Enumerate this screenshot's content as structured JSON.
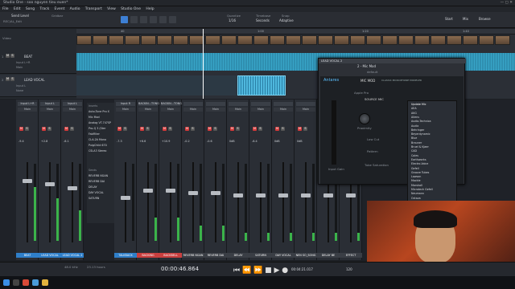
{
  "window_title": "Studio One - soo nguyen tieu euen*",
  "menu": [
    "File",
    "Edit",
    "Song",
    "Track",
    "Event",
    "Audio",
    "Transport",
    "View",
    "Studio One",
    "Help"
  ],
  "toolbar": {
    "song_label": "Send Level",
    "song_sub": "REC/AL_Edit",
    "gridbox": "Gridbar",
    "quantize_label": "Quantize",
    "quantize_value": "1/16",
    "timebase_label": "Timebase",
    "timebase_value": "Seconds",
    "snap_label": "Snap",
    "snap_value": "Adaptive",
    "start_label": "Start",
    "mix_label": "Mix",
    "browse_label": "Browse",
    "pct": "45%"
  },
  "tracks": [
    {
      "num": "1",
      "name": "BEAT",
      "io": "Input L+R",
      "out": "Main",
      "mute": "M",
      "solo": "S"
    },
    {
      "num": "2",
      "name": "LEAD VOCAL",
      "io": "Input L",
      "out": "None",
      "mute": "M",
      "solo": "S"
    }
  ],
  "ruler": [
    "40",
    "1:00",
    "1:20",
    "1:40"
  ],
  "mixer": {
    "strips": [
      {
        "input": "Input L+R",
        "main": "Main",
        "vol": "-9.4",
        "label": "BEAT",
        "color": "#2f7fc9",
        "level": 0.7
      },
      {
        "input": "Input L",
        "main": "Main",
        "vol": "+2.8",
        "label": "LEAD VOCAL",
        "color": "#2f7fc9",
        "level": 0.55
      },
      {
        "input": "Input L",
        "main": "Main",
        "vol": "-6.1",
        "label": "LEAD VOCAL 2",
        "color": "#2f7fc9",
        "level": 0.4
      },
      {
        "input": "Input R",
        "main": "Main",
        "vol": "-7.3",
        "label": "TALKBACK",
        "color": "#2f7fc9",
        "level": 0.0
      },
      {
        "input": "BACKIN...TONG",
        "main": "Main",
        "vol": "+6.6",
        "label": "BACKING",
        "color": "#c93f3f",
        "level": 0.3
      },
      {
        "input": "BACKIN...TONG",
        "main": "Main",
        "vol": "+10.9",
        "label": "BACKBELL",
        "color": "#c93f3f",
        "level": 0.3
      },
      {
        "input": "",
        "main": "Main",
        "vol": "-0.2",
        "label": "REVERB NGAN",
        "color": "#3a3e45",
        "level": 0.2
      },
      {
        "input": "",
        "main": "Main",
        "vol": "-0.6",
        "label": "REVERB DAI",
        "color": "#3a3e45",
        "level": 0.2
      },
      {
        "input": "",
        "main": "Main",
        "vol": "0dB",
        "label": "DELAY",
        "color": "#3a3e45",
        "level": 0.1
      },
      {
        "input": "",
        "main": "Main",
        "vol": "-6.4",
        "label": "SATURN",
        "color": "#3a3e45",
        "level": 0.1
      },
      {
        "input": "",
        "main": "Main",
        "vol": "0dB",
        "label": "DAY VOCAL",
        "color": "#3a3e45",
        "level": 0.1
      },
      {
        "input": "",
        "main": "Main",
        "vol": "0dB",
        "label": "NEN SO_SONG",
        "color": "#3a3e45",
        "level": 0.1
      },
      {
        "input": "",
        "main": "Main",
        "vol": "-4.0",
        "label": "DELAY BE",
        "color": "#3a3e45",
        "level": 0.1
      },
      {
        "input": "",
        "main": "Main",
        "vol": "0dB",
        "label": "EFFECT",
        "color": "#3a3e45",
        "level": 0.1
      }
    ],
    "inserts": [
      "Inserts",
      "Auto-Tune Pro X",
      "Mic Mod",
      "Analog VT-747SP",
      "Pro-Q 3 (Ster",
      "FabFilter",
      "CLA-2A Mono",
      "PuigChild 670",
      "CSLA3 Stereo"
    ],
    "sends": [
      "Sends",
      "REVERB NGAN",
      "REVERB DAI",
      "DELAY",
      "DAY VOCAL",
      "SATURN"
    ]
  },
  "plugin": {
    "title": "LEAD VOCAL 2",
    "slot": "2 - Mic Mod",
    "preset": "default",
    "brand": "Antares",
    "product": "MIC MOD",
    "subtitle": "CLASSIC MICROPHONE MODELER",
    "source_label": "SOURCE MIC",
    "source_value": "Apple Pro",
    "proximity": "Proximity",
    "lowcut": "Low Cut",
    "pattern": "Pattern",
    "tube": "Tube Saturation",
    "input_gain": "Input Gain",
    "mic_list": [
      "Update Mic",
      "AEA",
      "AKG",
      "Aliens",
      "Audio-Technica",
      "Audix",
      "Behringer",
      "Beyerdynamic",
      "Blue",
      "Brauner",
      "Bruel & Kjaer",
      "CAD",
      "Coles",
      "Earthworks",
      "Electro-Voice",
      "Gefell",
      "Groove Tubes",
      "Lawson",
      "Mackie",
      "Marshall",
      "Microtech Gefell",
      "Neumann",
      "Octava"
    ]
  },
  "transport": {
    "time": "00:00:46.864",
    "length": "00:04:21.017",
    "sample_rate": "48.0 kHz",
    "hours": "23.13 hours",
    "tempo": "120"
  },
  "colors": {
    "accent": "#3d7fd4",
    "beat": "#2f7fc9",
    "backing": "#c93f3f",
    "mute": "#d43a3a",
    "solo": "#e1b93a"
  }
}
